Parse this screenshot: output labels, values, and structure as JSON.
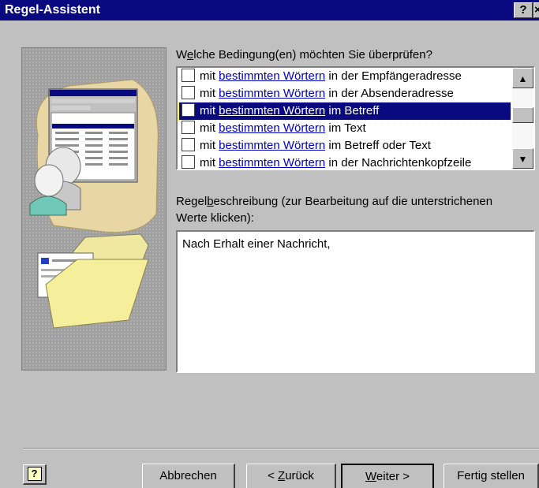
{
  "window": {
    "title": "Regel-Assistent",
    "help_glyph": "?",
    "close_glyph": "×"
  },
  "conditions": {
    "prompt_before": "W",
    "prompt_key": "e",
    "prompt_after": "lche Bedingung(en) möchten Sie überprüfen?",
    "rows": [
      {
        "prefix": "mit",
        "link": "bestimmten Wörtern",
        "suffix": "in der Empfängeradresse",
        "checked": false,
        "selected": false
      },
      {
        "prefix": "mit",
        "link": "bestimmten Wörtern",
        "suffix": "in der Absenderadresse",
        "checked": false,
        "selected": false
      },
      {
        "prefix": "mit",
        "link": "bestimmten Wörtern",
        "suffix": "im Betreff",
        "checked": false,
        "selected": true
      },
      {
        "prefix": "mit",
        "link": "bestimmten Wörtern",
        "suffix": "im Text",
        "checked": false,
        "selected": false
      },
      {
        "prefix": "mit",
        "link": "bestimmten Wörtern",
        "suffix": "im Betreff oder Text",
        "checked": false,
        "selected": false
      },
      {
        "prefix": "mit",
        "link": "bestimmten Wörtern",
        "suffix": "in der Nachrichtenkopfzeile",
        "checked": false,
        "selected": false
      }
    ],
    "scroll_up_glyph": "▲",
    "scroll_down_glyph": "▼"
  },
  "description": {
    "label_before": "Regel",
    "label_key": "b",
    "label_after": "eschreibung (zur Bearbeitung auf die unterstrichenen",
    "label_line2": "Werte klicken):",
    "text": "Nach Erhalt einer Nachricht,"
  },
  "buttons": {
    "help": "?",
    "cancel": "Abbrechen",
    "back_before": "< ",
    "back_key": "Z",
    "back_after": "urück",
    "next_key": "W",
    "next_after": "eiter >",
    "finish": "Fertig stellen"
  },
  "colors": {
    "title_bar": "#0a0a80",
    "selection": "#0a0a80",
    "link": "#0000c0",
    "face": "#c0c0c0"
  }
}
